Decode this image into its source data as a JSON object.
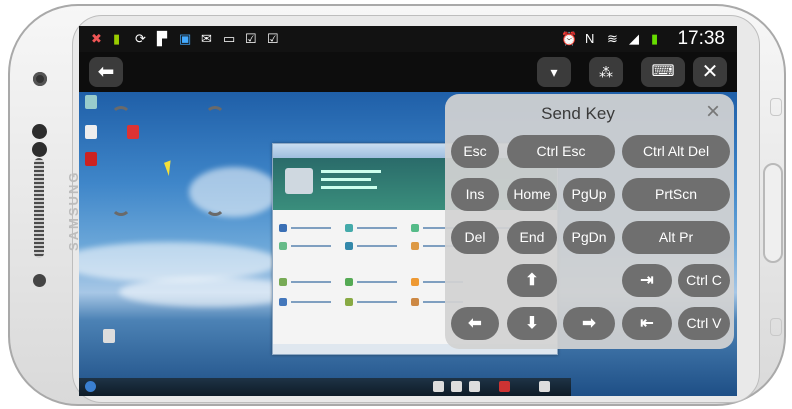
{
  "device": {
    "brand": "SAMSUNG"
  },
  "status_bar": {
    "time": "17:38",
    "left_icons": [
      "missed-call-icon",
      "android-icon",
      "sync-icon",
      "flipboard-icon",
      "app-icon",
      "gmail-icon",
      "message-icon",
      "bag-icon",
      "bag-icon"
    ],
    "right_icons": [
      "alarm-icon",
      "nfc-icon",
      "wifi-icon",
      "signal-icon",
      "battery-icon"
    ]
  },
  "toolbar": {
    "back_icon": "back-arrow-icon",
    "dropdown_icon": "dropdown-icon",
    "pointer_icon": "mouse-pointer-icon",
    "keyboard_icon": "keyboard-icon",
    "close_icon": "close-icon"
  },
  "send_key_panel": {
    "title": "Send Key",
    "close_label": "×",
    "keys": {
      "esc": "Esc",
      "ctrl_esc": "Ctrl Esc",
      "ctrl_alt_del": "Ctrl Alt Del",
      "ins": "Ins",
      "home": "Home",
      "pgup": "PgUp",
      "prtscn": "PrtScn",
      "del": "Del",
      "end": "End",
      "pgdn": "PgDn",
      "alt_pr": "Alt Pr",
      "up": "⬆",
      "tab": "⇥",
      "ctrl_c": "Ctrl C",
      "left": "⬅",
      "down": "⬇",
      "right": "➡",
      "back_tab": "⇤",
      "ctrl_v": "Ctrl V"
    }
  },
  "colors": {
    "panel_bg": "#d2d2d2",
    "key_bg": "#6f6f6f",
    "toolbar_bg": "#0d0d0d",
    "status_bg": "#121212"
  }
}
